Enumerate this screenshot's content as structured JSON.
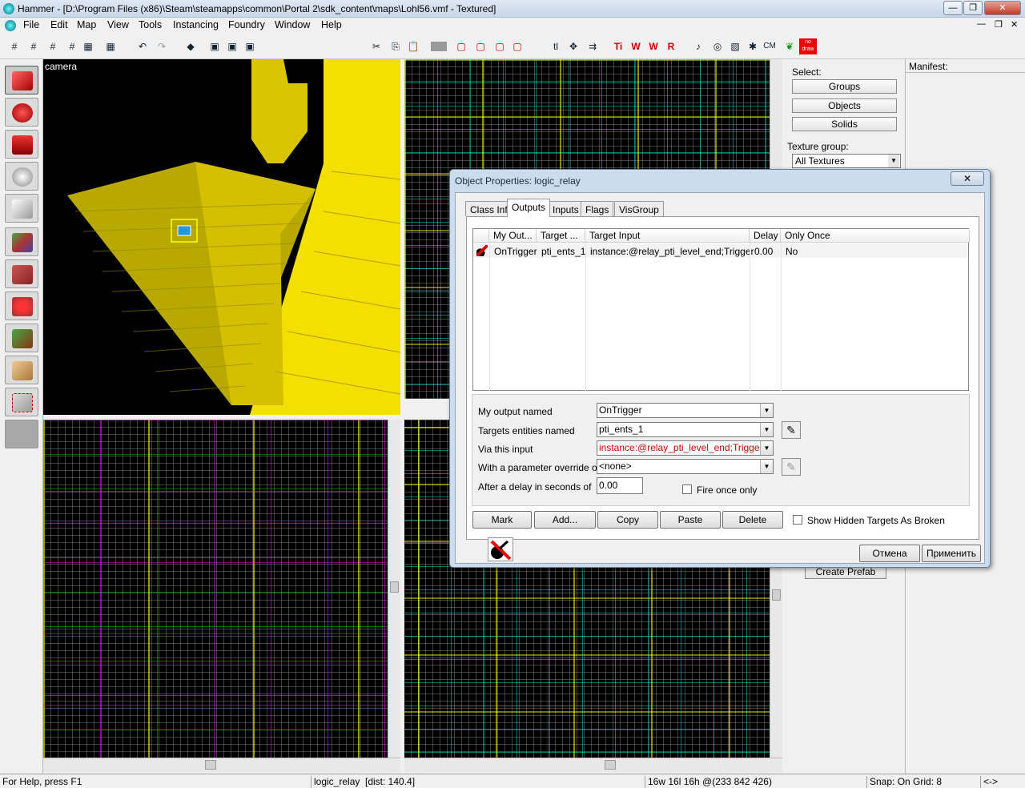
{
  "window": {
    "title": "Hammer - [D:\\Program Files (x86)\\Steam\\steamapps\\common\\Portal 2\\sdk_content\\maps\\Lohl56.vmf - Textured]",
    "min": "—",
    "max": "❐",
    "close": "✕"
  },
  "menu": {
    "items": [
      "File",
      "Edit",
      "Map",
      "View",
      "Tools",
      "Instancing",
      "Foundry",
      "Window",
      "Help"
    ]
  },
  "toolbar": {
    "cm_label": "CM",
    "nodraw_label": "no draw"
  },
  "viewports": {
    "camera_label": "camera"
  },
  "select_panel": {
    "label": "Select:",
    "groups": "Groups",
    "objects": "Objects",
    "solids": "Solids",
    "texture_group_label": "Texture group:",
    "texture_group_value": "All Textures",
    "create_prefab": "Create Prefab"
  },
  "manifest": {
    "label": "Manifest:"
  },
  "dialog": {
    "title": "Object Properties: logic_relay",
    "close": "✕",
    "tabs": [
      "Class Info",
      "Outputs",
      "Inputs",
      "Flags",
      "VisGroup"
    ],
    "active_tab": "Outputs",
    "columns": [
      "My Out...",
      "Target ...",
      "Target Input",
      "Delay",
      "Only Once"
    ],
    "rows": [
      {
        "output": "OnTrigger",
        "target": "pti_ents_1",
        "input": "instance:@relay_pti_level_end;Trigger",
        "delay": "0.00",
        "once": "No"
      }
    ],
    "fields": {
      "output_label": "My output named",
      "output_value": "OnTrigger",
      "target_label": "Targets entities named",
      "target_value": "pti_ents_1",
      "input_label": "Via this input",
      "input_value": "instance:@relay_pti_level_end;Trigger",
      "param_label": "With a parameter override of",
      "param_value": "<none>",
      "delay_label": "After a delay in seconds of",
      "delay_value": "0.00",
      "fire_once_label": "Fire once only"
    },
    "buttons": {
      "mark": "Mark",
      "add": "Add...",
      "copy": "Copy",
      "paste": "Paste",
      "delete": "Delete",
      "show_hidden": "Show Hidden Targets As Broken",
      "cancel": "Отмена",
      "apply": "Применить"
    },
    "colors": {
      "input_invalid": "#cc0000"
    }
  },
  "status": {
    "help": "For Help, press F1",
    "selection": "logic_relay",
    "dist": "[dist: 140.4]",
    "size": "16w 16l 16h @(233 842 426)",
    "snap": "Snap: On Grid: 8",
    "arrows": "<->"
  }
}
